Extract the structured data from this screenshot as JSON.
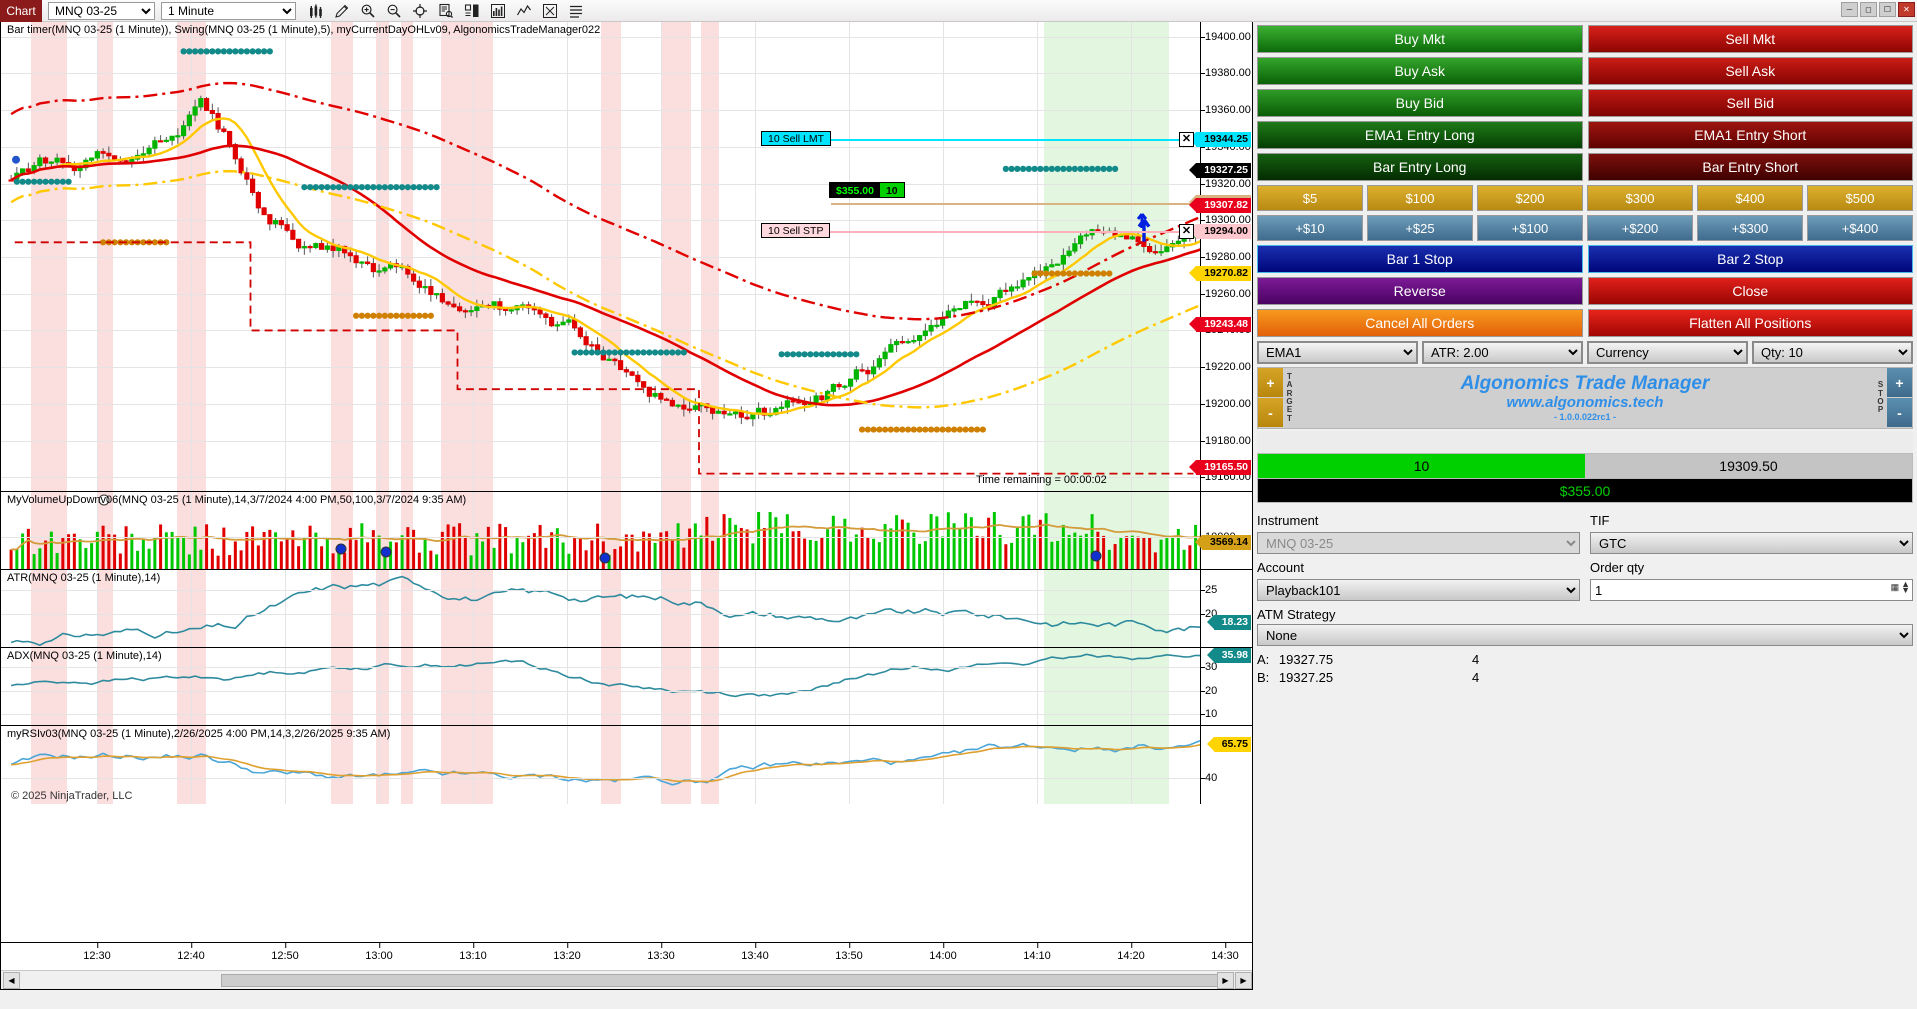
{
  "toolbar": {
    "chart_tab": "Chart",
    "instrument": "MNQ 03-25",
    "interval": "1 Minute",
    "icons": [
      "bar-chart-icon",
      "pencil-icon",
      "zoom-in-icon",
      "zoom-out-icon",
      "crosshair-icon",
      "data-box-icon",
      "layout-icon",
      "histogram-icon",
      "line-chart-icon",
      "template-icon",
      "list-icon"
    ],
    "window_buttons": [
      "minimize",
      "restore",
      "maximize",
      "close"
    ]
  },
  "chart": {
    "indicator_header": "Bar timer(MNQ 03-25 (1 Minute)), Swing(MNQ 03-25 (1 Minute),5), myCurrentDayOHLv09, AlgonomicsTradeManager022",
    "time_remaining": "Time remaining = 00:00:02",
    "copyright": "© 2025 NinjaTrader, LLC",
    "price_ticks": [
      "19400.00",
      "19380.00",
      "19360.00",
      "19340.00",
      "19320.00",
      "19300.00",
      "19280.00",
      "19260.00",
      "19240.00",
      "19220.00",
      "19200.00",
      "19180.00",
      "19160.00"
    ],
    "price_tags": [
      {
        "value": "19344.25",
        "color": "cyan"
      },
      {
        "value": "19327.25",
        "color": "black"
      },
      {
        "value": "19309.50",
        "color": "tan"
      },
      {
        "value": "19307.82",
        "color": "red"
      },
      {
        "value": "19294.00",
        "color": "pink"
      },
      {
        "value": "19270.82",
        "color": "gold"
      },
      {
        "value": "19243.48",
        "color": "red"
      },
      {
        "value": "19165.50",
        "color": "red"
      }
    ],
    "orders": [
      {
        "label": "10  Sell LMT",
        "type": "lmt"
      },
      {
        "label": "10  Sell STP",
        "type": "stp"
      }
    ],
    "pnl_overlay": {
      "amount": "$355.00",
      "qty": "10"
    },
    "time_labels": [
      "12:30",
      "12:40",
      "12:50",
      "13:00",
      "13:10",
      "13:20",
      "13:30",
      "13:40",
      "13:50",
      "14:00",
      "14:10",
      "14:20",
      "14:30"
    ]
  },
  "panels": [
    {
      "label": "MyVolumeUpDownv06(MNQ 03-25 (1 Minute),14,3/7/2024 4:00 PM,50,100,3/7/2024 9:35 AM)",
      "ticks": [
        "10000"
      ],
      "tag": {
        "value": "3569.14",
        "color": "amber"
      }
    },
    {
      "label": "ATR(MNQ 03-25 (1 Minute),14)",
      "ticks": [
        "25",
        "20"
      ],
      "tag": {
        "value": "18.23",
        "color": "teal"
      }
    },
    {
      "label": "ADX(MNQ 03-25 (1 Minute),14)",
      "ticks": [
        "30",
        "20",
        "10"
      ],
      "tag": {
        "value": "35.98",
        "color": "teal"
      }
    },
    {
      "label": "myRSIv03(MNQ 03-25 (1 Minute),2/26/2025 4:00 PM,14,3,2/26/2025 9:35 AM)",
      "ticks": [
        "40"
      ],
      "tag": {
        "value": "65.75",
        "color": "gold"
      }
    }
  ],
  "trade_panel": {
    "rows": [
      {
        "left": "Buy Mkt",
        "right": "Sell Mkt"
      },
      {
        "left": "Buy Ask",
        "right": "Sell Ask"
      },
      {
        "left": "Buy Bid",
        "right": "Sell Bid"
      },
      {
        "left": "EMA1 Entry Long",
        "right": "EMA1 Entry Short"
      },
      {
        "left": "Bar Entry Long",
        "right": "Bar Entry Short"
      }
    ],
    "amount_buttons": [
      "$5",
      "$100",
      "$200",
      "$300",
      "$400",
      "$500"
    ],
    "increment_buttons": [
      "+$10",
      "+$25",
      "+$100",
      "+$200",
      "+$300",
      "+$400"
    ],
    "stop_buttons": {
      "left": "Bar 1 Stop",
      "right": "Bar 2 Stop"
    },
    "reverse_close": {
      "left": "Reverse",
      "right": "Close"
    },
    "cancel_flatten": {
      "left": "Cancel All Orders",
      "right": "Flatten All Positions"
    },
    "selectors": [
      "EMA1",
      "ATR: 2.00",
      "Currency",
      "Qty: 10"
    ],
    "brand": {
      "title": "Algonomics Trade Manager",
      "url": "www.algonomics.tech",
      "version": "- 1.0.0.022rc1 -",
      "target_label": "TARGET",
      "stop_label": "STOP",
      "plus": "+",
      "minus": "-"
    },
    "position": {
      "qty": "10",
      "price": "19309.50",
      "pnl": "$355.00"
    },
    "form": {
      "instrument_label": "Instrument",
      "instrument_value": "MNQ 03-25",
      "tif_label": "TIF",
      "tif_value": "GTC",
      "account_label": "Account",
      "account_value": "Playback101",
      "order_qty_label": "Order qty",
      "order_qty_value": "1",
      "atm_label": "ATM Strategy",
      "atm_value": "None",
      "a_label": "A:",
      "a_value": "19327.75",
      "a_qty": "4",
      "b_label": "B:",
      "b_value": "19327.25",
      "b_qty": "4"
    }
  },
  "colors": {
    "buy_green": "#0b6b08",
    "sell_red": "#8e0502",
    "gold": "#b8860b",
    "navy": "#00067a",
    "purple": "#4a0263",
    "orange": "#e3600a",
    "brand_blue": "#2f8fe8",
    "cyan_order": "#00e5ff",
    "profit_green": "#00d000"
  }
}
